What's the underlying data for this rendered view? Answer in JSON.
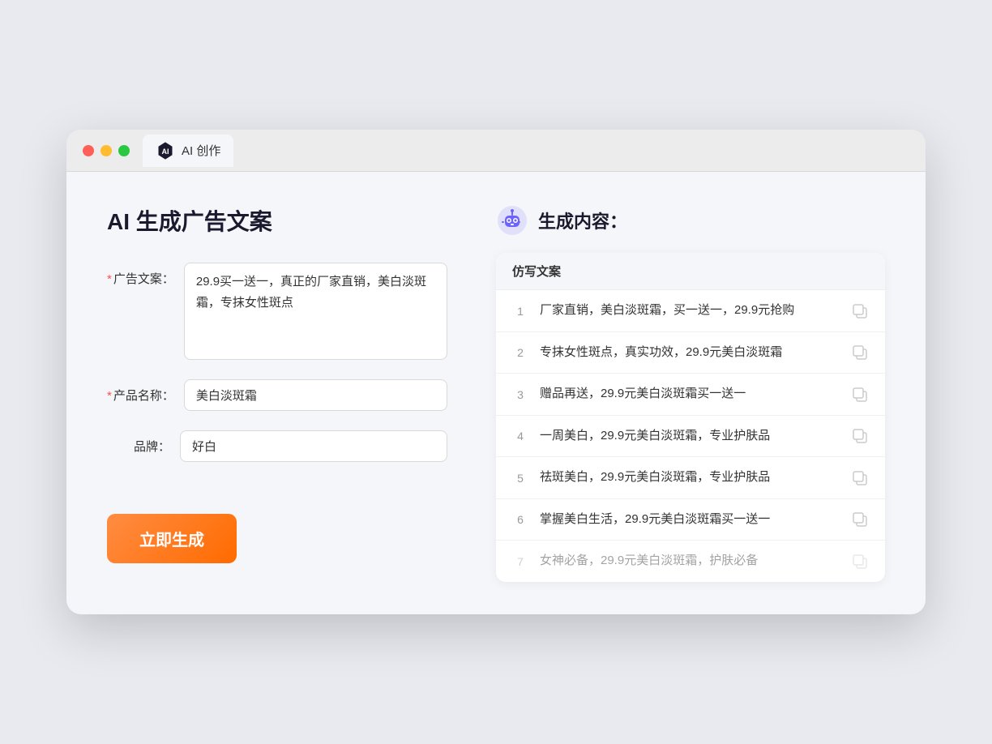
{
  "tab": {
    "label": "AI 创作"
  },
  "page": {
    "title": "AI 生成广告文案"
  },
  "form": {
    "ad_copy_label": "广告文案：",
    "ad_copy_required": "*",
    "ad_copy_value": "29.9买一送一，真正的厂家直销，美白淡斑霜，专抹女性斑点",
    "product_name_label": "产品名称：",
    "product_name_required": "*",
    "product_name_value": "美白淡斑霜",
    "brand_label": "品牌：",
    "brand_value": "好白",
    "generate_btn_label": "立即生成"
  },
  "result": {
    "title": "生成内容：",
    "column_label": "仿写文案",
    "items": [
      {
        "num": "1",
        "text": "厂家直销，美白淡斑霜，买一送一，29.9元抢购"
      },
      {
        "num": "2",
        "text": "专抹女性斑点，真实功效，29.9元美白淡斑霜"
      },
      {
        "num": "3",
        "text": "赠品再送，29.9元美白淡斑霜买一送一"
      },
      {
        "num": "4",
        "text": "一周美白，29.9元美白淡斑霜，专业护肤品"
      },
      {
        "num": "5",
        "text": "祛斑美白，29.9元美白淡斑霜，专业护肤品"
      },
      {
        "num": "6",
        "text": "掌握美白生活，29.9元美白淡斑霜买一送一"
      },
      {
        "num": "7",
        "text": "女神必备，29.9元美白淡斑霜，护肤必备"
      }
    ]
  }
}
